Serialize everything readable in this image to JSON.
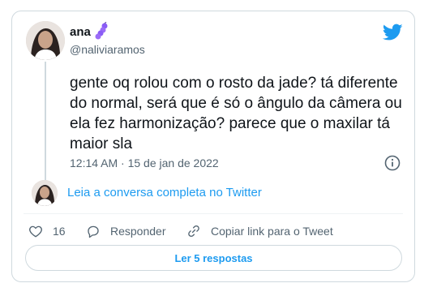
{
  "tweet": {
    "author_name": "ana",
    "author_handle": "@naliviaramos",
    "text": "gente oq rolou com o rosto da jade? tá diferente do normal, será que é só o ângulo da câmera ou ela fez harmonização? parece que o maxilar tá maior sla",
    "timestamp": "12:14 AM · 15 de jan de 2022"
  },
  "thread": {
    "read_link": "Leia a conversa completa no Twitter"
  },
  "actions": {
    "like_count": "16",
    "reply_label": "Responder",
    "copy_label": "Copiar link para o Tweet"
  },
  "replies_button": "Ler 5 respostas",
  "colors": {
    "accent": "#1d9bf0",
    "muted": "#536471",
    "text": "#0f1419",
    "border": "#cfd9de",
    "like_icon": "#536471",
    "emoji": "#8a5cf6"
  },
  "icons": [
    "twitter-bird-icon",
    "caterpillar-emoji-icon",
    "info-icon",
    "heart-icon",
    "reply-bubble-icon",
    "link-icon"
  ]
}
